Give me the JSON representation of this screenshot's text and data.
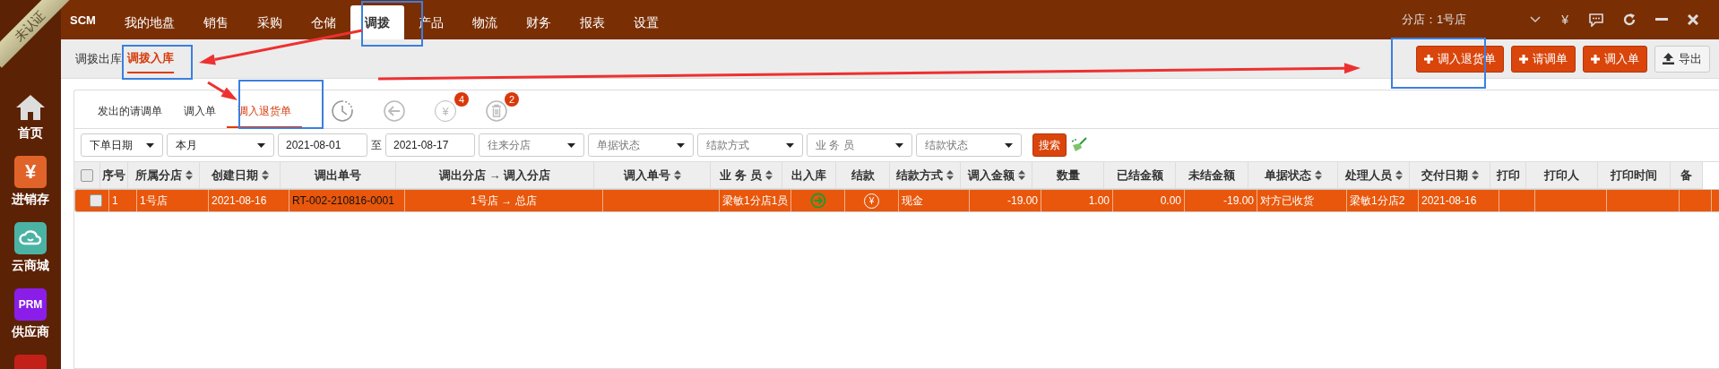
{
  "badge": "未认证",
  "sidebar": [
    {
      "kind": "home",
      "label": "首页"
    },
    {
      "kind": "yen",
      "label": "进销存",
      "icon_text": "¥"
    },
    {
      "kind": "cloud",
      "label": "云商城"
    },
    {
      "kind": "prm",
      "label": "供应商",
      "icon_text": "PRM"
    },
    {
      "kind": "red"
    }
  ],
  "top_nav": {
    "logo": "SCM",
    "items": [
      {
        "label": "我的地盘",
        "selected": false
      },
      {
        "label": "销售",
        "selected": false
      },
      {
        "label": "采购",
        "selected": false
      },
      {
        "label": "仓储",
        "selected": false
      },
      {
        "label": "调拨",
        "selected": true
      },
      {
        "label": "产品",
        "selected": false
      },
      {
        "label": "物流",
        "selected": false
      },
      {
        "label": "财务",
        "selected": false
      },
      {
        "label": "报表",
        "selected": false
      },
      {
        "label": "设置",
        "selected": false
      }
    ],
    "branch": "分店：1号店",
    "currency": "¥"
  },
  "sub_nav": [
    {
      "label": "调拨出库",
      "selected": false
    },
    {
      "label": "调拨入库",
      "selected": true
    }
  ],
  "actions": [
    {
      "kind": "primary",
      "label": "调入退货单"
    },
    {
      "kind": "primary",
      "label": "请调单"
    },
    {
      "kind": "primary",
      "label": "调入单"
    },
    {
      "kind": "export",
      "label": "导出"
    }
  ],
  "tabs": [
    {
      "label": "发出的请调单",
      "selected": false
    },
    {
      "label": "调入单",
      "selected": false
    },
    {
      "label": "调入退货单",
      "selected": true
    }
  ],
  "tab_icons": [
    {
      "kind": "clock"
    },
    {
      "kind": "back"
    },
    {
      "kind": "yen",
      "icon_text": "¥",
      "badge": "4"
    },
    {
      "kind": "trash",
      "badge": "2"
    }
  ],
  "filters": [
    {
      "kind": "select",
      "value": "下单日期"
    },
    {
      "kind": "select",
      "value": "本月"
    },
    {
      "kind": "input",
      "value": "2021-08-01"
    },
    {
      "kind": "text",
      "label": "至"
    },
    {
      "kind": "input",
      "value": "2021-08-17"
    },
    {
      "kind": "select",
      "placeholder": "往来分店"
    },
    {
      "kind": "select",
      "placeholder": "单据状态"
    },
    {
      "kind": "select",
      "placeholder": "结款方式"
    },
    {
      "kind": "select",
      "placeholder": "业 务 员"
    },
    {
      "kind": "select",
      "placeholder": "结款状态"
    }
  ],
  "search_button": "搜索",
  "table": {
    "all_checked": false,
    "columns": [
      {
        "label": "序号"
      },
      {
        "label": "所属分店",
        "sortable": true
      },
      {
        "label": "创建日期",
        "sortable": true
      },
      {
        "label": "调出单号"
      },
      {
        "label": "调出分店 → 调入分店"
      },
      {
        "label": "调入单号",
        "sortable": true
      },
      {
        "label": "业 务 员",
        "sortable": true
      },
      {
        "label": "出入库"
      },
      {
        "label": "结款"
      },
      {
        "label": "结款方式",
        "sortable": true
      },
      {
        "label": "调入金额",
        "sortable": true
      },
      {
        "label": "数量"
      },
      {
        "label": "已结金额"
      },
      {
        "label": "未结金额"
      },
      {
        "label": "单据状态",
        "sortable": true
      },
      {
        "label": "处理人员",
        "sortable": true
      },
      {
        "label": "交付日期",
        "sortable": true
      },
      {
        "label": "打印"
      },
      {
        "label": "打印人"
      },
      {
        "label": "打印时间"
      },
      {
        "label": "备"
      }
    ],
    "rows": [
      {
        "selected": true,
        "checked": false,
        "cells": [
          {
            "text": "1"
          },
          {
            "text": "1号店"
          },
          {
            "text": "2021-08-16"
          },
          {
            "text": "RT-002-210816-0001"
          },
          {
            "text": "1号店 → 总店"
          },
          {
            "kind": "empty"
          },
          {
            "text": "梁敏1分店1员"
          },
          {
            "kind": "in"
          },
          {
            "kind": "settle",
            "icon_text": "¥"
          },
          {
            "text": "现金"
          },
          {
            "text": "-19.00"
          },
          {
            "text": "1.00"
          },
          {
            "text": "0.00"
          },
          {
            "text": "-19.00"
          },
          {
            "text": "对方已收货"
          },
          {
            "text": "梁敏1分店2"
          },
          {
            "text": "2021-08-16"
          },
          {
            "kind": "empty"
          },
          {
            "kind": "empty"
          },
          {
            "kind": "empty"
          },
          {
            "kind": "empty"
          }
        ]
      }
    ]
  }
}
